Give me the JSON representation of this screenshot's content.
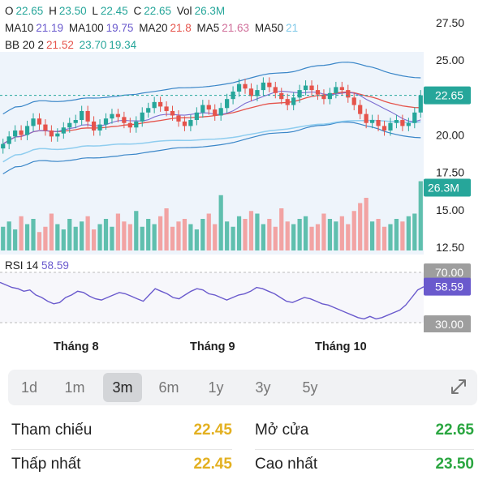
{
  "legend": {
    "ohlc": [
      {
        "label": "O",
        "value": "22.65"
      },
      {
        "label": "H",
        "value": "23.50"
      },
      {
        "label": "L",
        "value": "22.45"
      },
      {
        "label": "C",
        "value": "22.65"
      },
      {
        "label": "Vol",
        "value": "26.3M"
      }
    ],
    "ma": [
      {
        "label": "MA10",
        "value": "21.19"
      },
      {
        "label": "MA100",
        "value": "19.75"
      },
      {
        "label": "MA20",
        "value": "21.8"
      },
      {
        "label": "MA5",
        "value": "21.63"
      },
      {
        "label": "MA50",
        "value": "21"
      }
    ],
    "bb": {
      "label": "BB 20 2",
      "values": [
        "21.52",
        "23.70",
        "19.34"
      ]
    }
  },
  "price_axis": [
    "27.50",
    "25.00",
    "22.50",
    "20.00",
    "17.50",
    "15.00",
    "12.50"
  ],
  "price_badge": "22.65",
  "volume_badge": "26.3M",
  "rsi": {
    "label": "RSI 14",
    "value": "58.59",
    "upper": "70.00",
    "lower": "30.00"
  },
  "months": [
    "Tháng 8",
    "Tháng 9",
    "Tháng 10"
  ],
  "ranges": [
    {
      "label": "1d",
      "active": false
    },
    {
      "label": "1m",
      "active": false
    },
    {
      "label": "3m",
      "active": true
    },
    {
      "label": "6m",
      "active": false
    },
    {
      "label": "1y",
      "active": false
    },
    {
      "label": "3y",
      "active": false
    },
    {
      "label": "5y",
      "active": false
    }
  ],
  "stats": {
    "ref_label": "Tham chiếu",
    "ref_value": "22.45",
    "open_label": "Mở cửa",
    "open_value": "22.65",
    "low_label": "Thấp nhất",
    "low_value": "22.45",
    "high_label": "Cao nhất",
    "high_value": "23.50"
  },
  "chart_data": {
    "type": "candlestick",
    "price_range": [
      12.5,
      27.5
    ],
    "closes": [
      19.4,
      19.9,
      20.3,
      20.0,
      20.6,
      21.1,
      20.7,
      20.3,
      19.9,
      20.1,
      20.5,
      20.8,
      21.0,
      21.6,
      20.9,
      20.3,
      20.7,
      21.1,
      21.4,
      21.2,
      20.8,
      20.5,
      20.9,
      21.5,
      21.8,
      22.2,
      21.9,
      21.6,
      21.3,
      20.9,
      20.6,
      21.0,
      21.5,
      22.0,
      21.7,
      21.3,
      21.8,
      22.4,
      22.9,
      23.4,
      23.1,
      22.6,
      23.0,
      23.5,
      23.2,
      22.8,
      22.4,
      22.0,
      22.5,
      23.0,
      23.3,
      23.0,
      22.7,
      22.4,
      22.8,
      23.2,
      23.0,
      22.5,
      22.0,
      21.4,
      20.8,
      21.0,
      20.6,
      20.3,
      20.8,
      21.0,
      20.6,
      20.8,
      21.5,
      22.65
    ],
    "volumes": [
      9,
      11,
      8,
      13,
      10,
      12,
      7,
      9,
      14,
      10,
      8,
      12,
      9,
      11,
      13,
      8,
      10,
      12,
      9,
      14,
      11,
      10,
      15,
      9,
      12,
      10,
      13,
      16,
      9,
      11,
      12,
      10,
      8,
      12,
      14,
      10,
      21,
      11,
      9,
      13,
      12,
      15,
      14,
      10,
      12,
      9,
      16,
      11,
      10,
      12,
      13,
      9,
      10,
      14,
      12,
      11,
      13,
      10,
      15,
      18,
      20,
      11,
      12,
      9,
      10,
      12,
      11,
      13,
      14,
      26.3
    ],
    "rsi_values": [
      62,
      60,
      58,
      57,
      55,
      56,
      52,
      50,
      47,
      45,
      46,
      50,
      52,
      55,
      54,
      51,
      49,
      48,
      50,
      52,
      54,
      53,
      51,
      49,
      47,
      52,
      57,
      55,
      53,
      50,
      49,
      52,
      55,
      57,
      56,
      53,
      52,
      50,
      48,
      50,
      52,
      53,
      55,
      58,
      57,
      55,
      53,
      50,
      47,
      46,
      48,
      50,
      49,
      47,
      45,
      44,
      42,
      40,
      38,
      36,
      34,
      33,
      35,
      33,
      34,
      36,
      38,
      40,
      44,
      50,
      56,
      58.59
    ]
  }
}
